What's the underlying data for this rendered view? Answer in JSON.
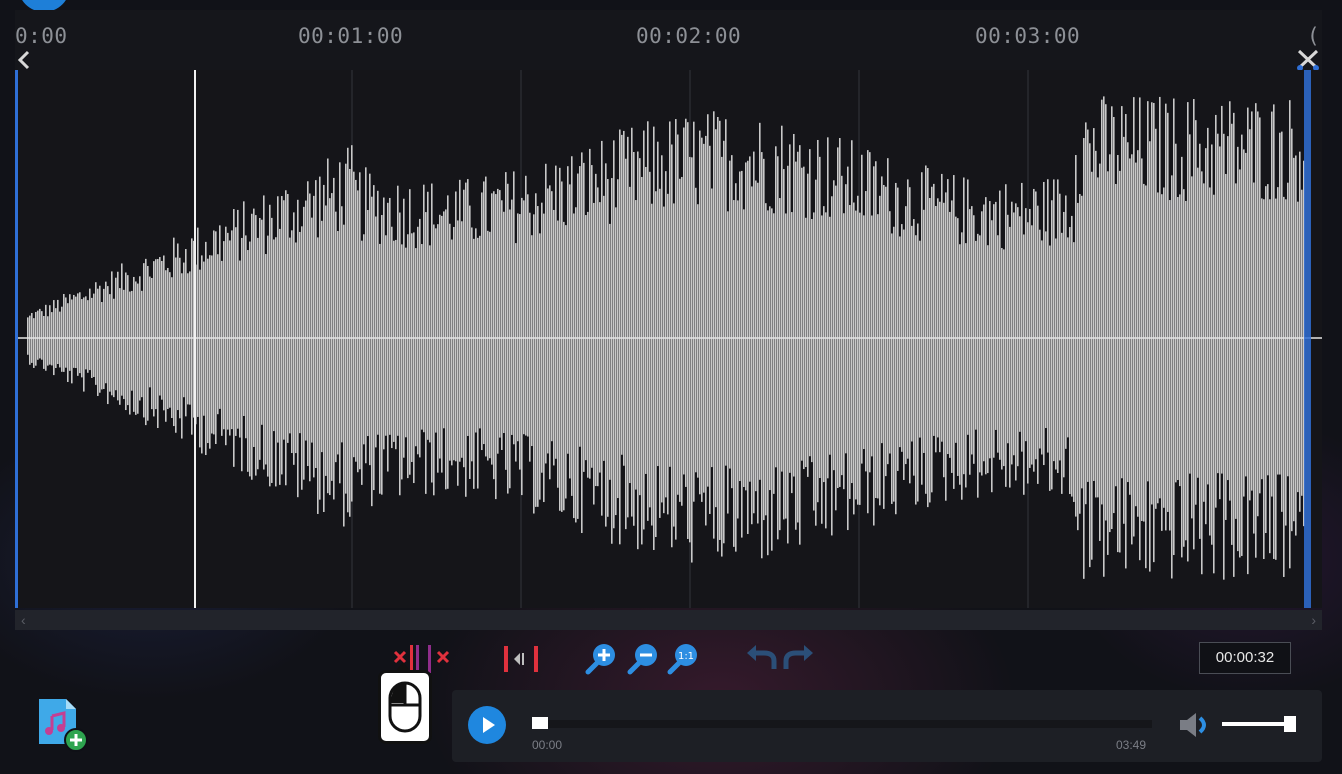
{
  "ruler": {
    "labels": [
      "0:00",
      "00:01:00",
      "00:02:00",
      "00:03:00",
      "("
    ]
  },
  "waveform": {
    "background": "#151519",
    "wave_color": "#c9c9c9",
    "selection_marker_color": "#2f6fd6"
  },
  "toolbar": {
    "icons": [
      "cut-before-icon",
      "cut-after-icon",
      "trim-selection-icon",
      "zoom-in-icon",
      "zoom-out-icon",
      "zoom-reset-icon",
      "undo-icon",
      "redo-icon"
    ],
    "current_time": "00:00:32",
    "cut_color": "#e0313d",
    "zoom_color": "#2d8ee2"
  },
  "player": {
    "start_time": "00:00",
    "end_time": "03:49",
    "progress": 0.0,
    "volume": 0.95,
    "accent": "#1f87df"
  },
  "add_file": {
    "icon": "add-music-file-icon"
  }
}
